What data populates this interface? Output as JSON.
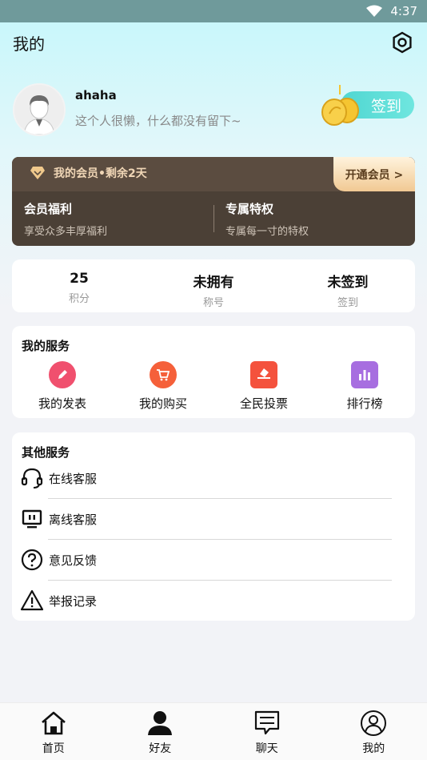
{
  "status": {
    "time": "4:37",
    "wifi_icon": "wifi-icon",
    "battery_icon": "battery-icon"
  },
  "header": {
    "title": "我的",
    "settings_icon": "gear-icon"
  },
  "profile": {
    "username": "ahaha",
    "bio": "这个人很懒，什么都没有留下~",
    "signin_label": "签到"
  },
  "vip": {
    "title": "我的会员•剩余2天",
    "open_label": "开通会员 >",
    "benefit_title": "会员福利",
    "benefit_desc": "享受众多丰厚福利",
    "privilege_title": "专属特权",
    "privilege_desc": "专属每一寸的特权",
    "colors": {
      "bg": "#4b4036",
      "accent": "#f1c993"
    }
  },
  "stats": [
    {
      "value": "25",
      "label": "积分"
    },
    {
      "value": "未拥有",
      "label": "称号"
    },
    {
      "value": "未签到",
      "label": "签到"
    }
  ],
  "services": {
    "title": "我的服务",
    "items": [
      {
        "label": "我的发表",
        "icon": "pencil-icon",
        "color": "#f0506e"
      },
      {
        "label": "我的购买",
        "icon": "cart-icon",
        "color": "#f5603a"
      },
      {
        "label": "全民投票",
        "icon": "vote-icon",
        "color": "#f4523d"
      },
      {
        "label": "排行榜",
        "icon": "bar-chart-icon",
        "color": "#a76ee0"
      }
    ]
  },
  "other": {
    "title": "其他服务",
    "items": [
      {
        "label": "在线客服",
        "icon": "headset-icon"
      },
      {
        "label": "离线客服",
        "icon": "monitor-icon"
      },
      {
        "label": "意见反馈",
        "icon": "question-icon"
      },
      {
        "label": "举报记录",
        "icon": "warning-icon"
      }
    ]
  },
  "tabs": [
    {
      "label": "首页",
      "icon": "home-icon"
    },
    {
      "label": "好友",
      "icon": "person-icon"
    },
    {
      "label": "聊天",
      "icon": "chat-icon"
    },
    {
      "label": "我的",
      "icon": "profile-icon"
    }
  ]
}
